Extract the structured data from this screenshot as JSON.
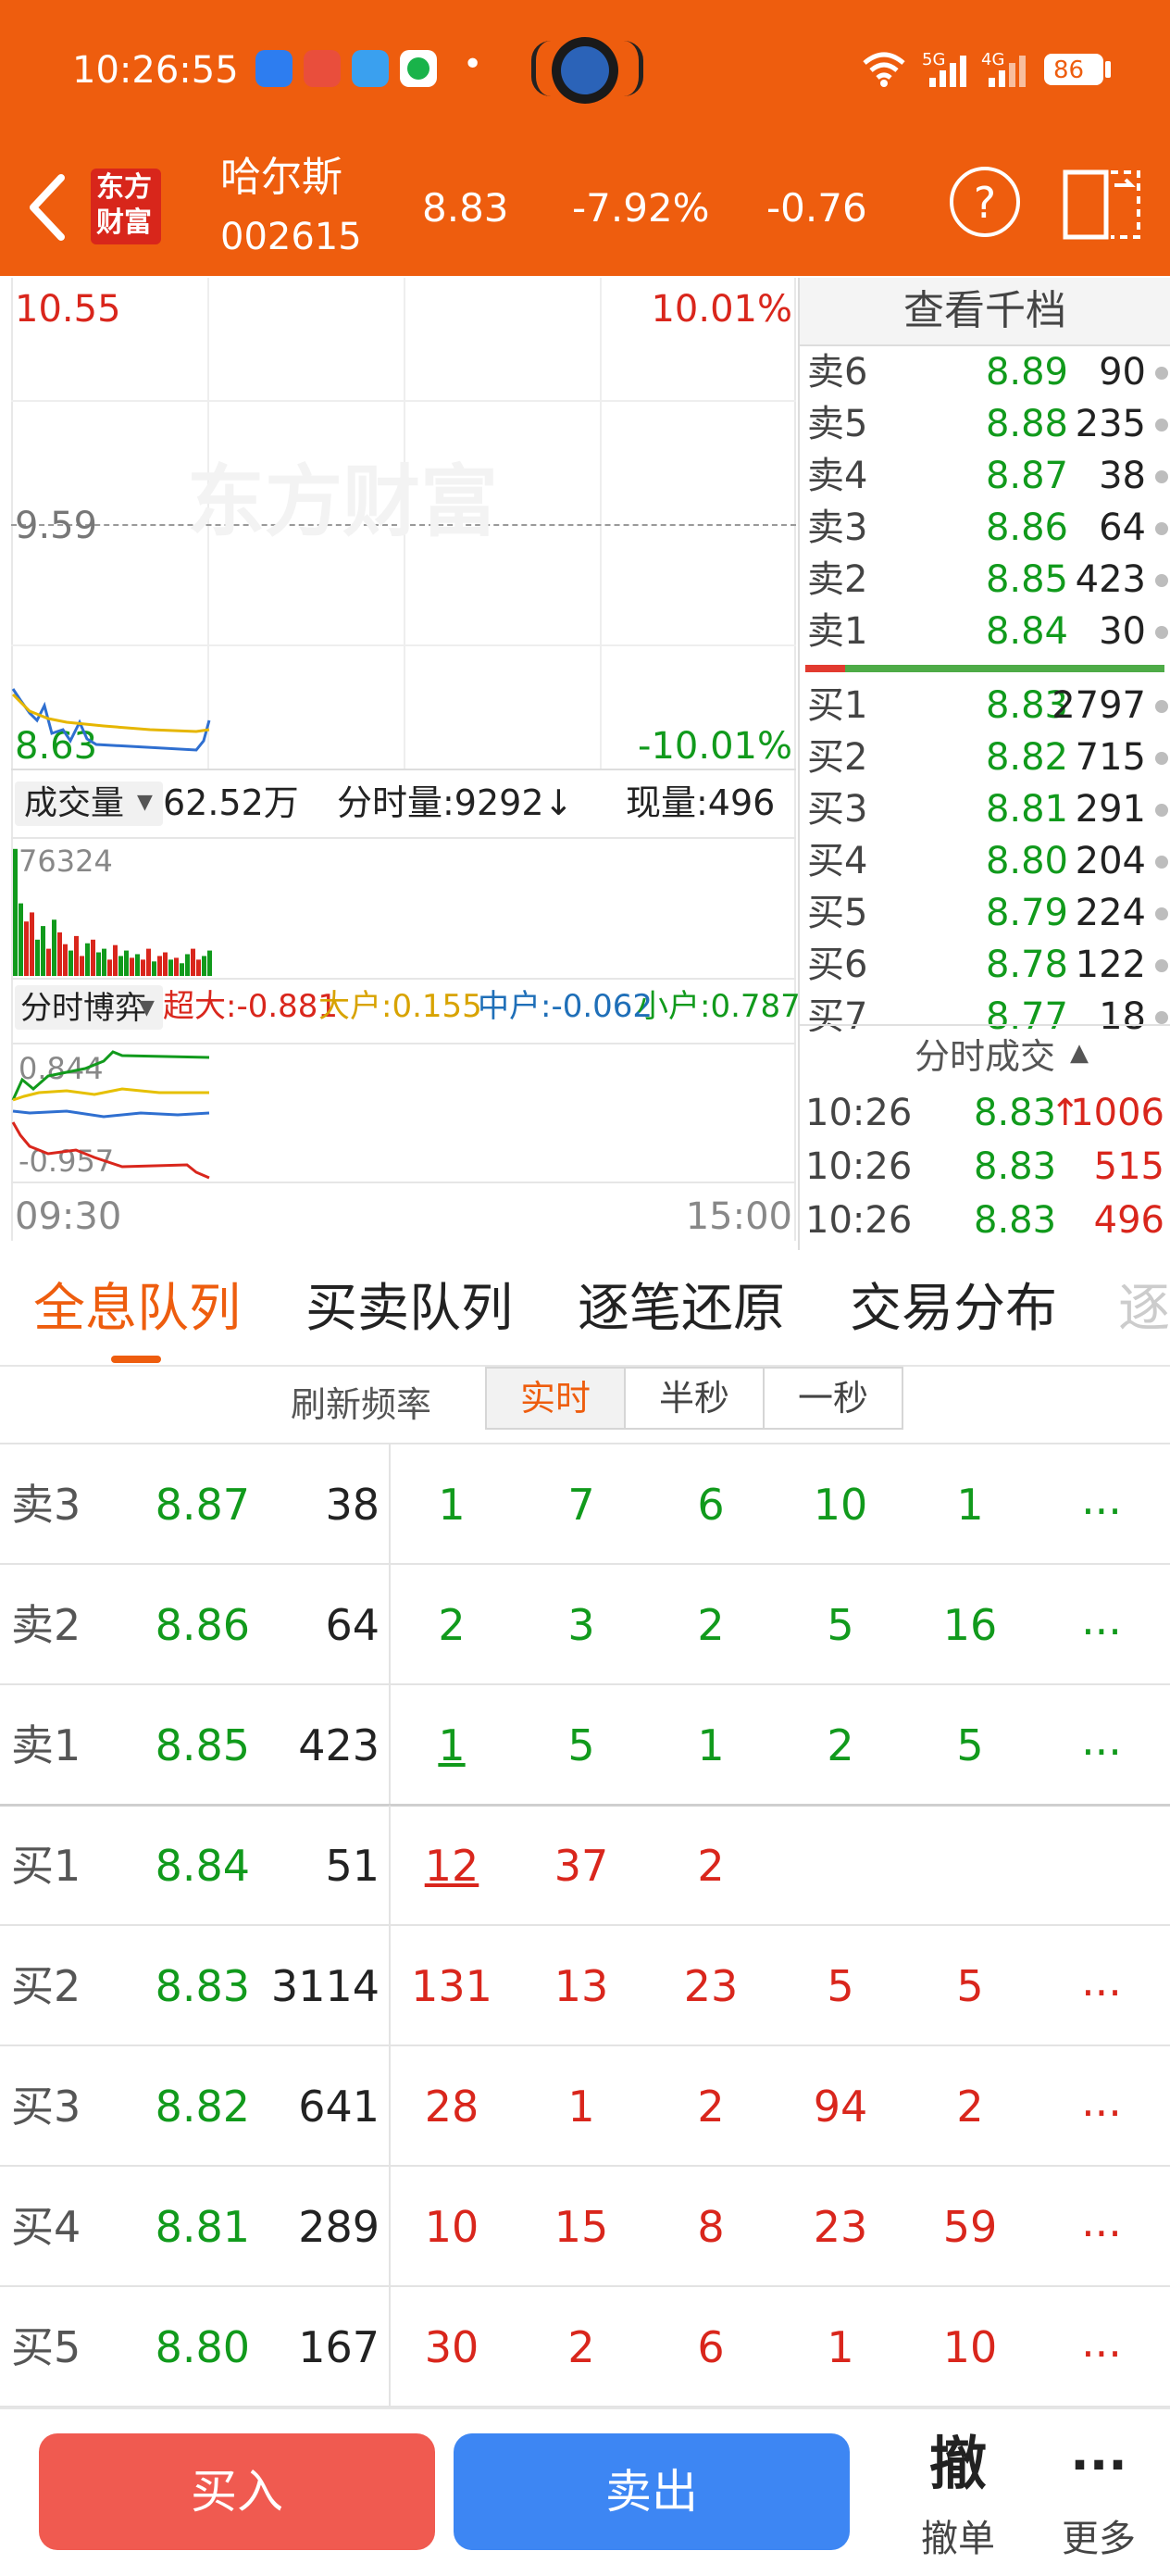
{
  "status_bar": {
    "time": "10:26:55",
    "signal_5g": "5G",
    "signal_4g": "4G",
    "battery": "86",
    "app_dot": "•"
  },
  "header": {
    "logo_line1": "东方",
    "logo_line2": "财富",
    "stock_name": "哈尔斯",
    "stock_code": "002615",
    "price": "8.83",
    "change_pct": "-7.92%",
    "change": "-0.76",
    "help": "?"
  },
  "chart": {
    "price_high": "10.55",
    "pct_high": "10.01%",
    "price_mid": "9.59",
    "price_low": "8.63",
    "pct_low": "-10.01%",
    "watermark": "东方财富",
    "volume_selector": "成交量",
    "volume_total": "62.52万",
    "fenshi_label": "分时量:9292↓",
    "current_label": "现量:496",
    "vol_max": "76324",
    "boyi_selector": "分时博弈",
    "chaoda": "超大:-0.881",
    "dahu": "大户:0.155",
    "zhonghu": "中户:-0.062",
    "xiaohu": "小户:0.787",
    "boyi_max": "0.844",
    "boyi_min": "-0.957",
    "time_start": "09:30",
    "time_end": "15:00"
  },
  "orderbook": {
    "title": "查看千档",
    "asks": [
      {
        "label": "卖6",
        "price": "8.89",
        "vol": "90"
      },
      {
        "label": "卖5",
        "price": "8.88",
        "vol": "235"
      },
      {
        "label": "卖4",
        "price": "8.87",
        "vol": "38"
      },
      {
        "label": "卖3",
        "price": "8.86",
        "vol": "64"
      },
      {
        "label": "卖2",
        "price": "8.85",
        "vol": "423"
      },
      {
        "label": "卖1",
        "price": "8.84",
        "vol": "30"
      }
    ],
    "bids": [
      {
        "label": "买1",
        "price": "8.83",
        "vol": "2797"
      },
      {
        "label": "买2",
        "price": "8.82",
        "vol": "715"
      },
      {
        "label": "买3",
        "price": "8.81",
        "vol": "291"
      },
      {
        "label": "买4",
        "price": "8.80",
        "vol": "204"
      },
      {
        "label": "买5",
        "price": "8.79",
        "vol": "224"
      },
      {
        "label": "买6",
        "price": "8.78",
        "vol": "122"
      },
      {
        "label": "买7",
        "price": "8.77",
        "vol": "18"
      }
    ],
    "buy_ratio": 0.11
  },
  "ticks": {
    "title": "分时成交",
    "rows": [
      {
        "time": "10:26",
        "price": "8.83",
        "vol": "1006",
        "arrow": "↑"
      },
      {
        "time": "10:26",
        "price": "8.83",
        "vol": "515",
        "arrow": ""
      },
      {
        "time": "10:26",
        "price": "8.83",
        "vol": "496",
        "arrow": ""
      }
    ]
  },
  "tabs": [
    "全息队列",
    "买卖队列",
    "逐笔还原",
    "交易分布",
    "逐"
  ],
  "refresh": {
    "label": "刷新频率",
    "options": [
      "实时",
      "半秒",
      "一秒"
    ]
  },
  "queue": {
    "rows": [
      {
        "label": "卖3",
        "price": "8.87",
        "vol": "38",
        "orders": [
          "1",
          "7",
          "6",
          "10",
          "1"
        ],
        "more": "..."
      },
      {
        "label": "卖2",
        "price": "8.86",
        "vol": "64",
        "orders": [
          "2",
          "3",
          "2",
          "5",
          "16"
        ],
        "more": "..."
      },
      {
        "label": "卖1",
        "price": "8.85",
        "vol": "423",
        "orders": [
          "1",
          "5",
          "1",
          "2",
          "5"
        ],
        "more": "..."
      },
      {
        "label": "买1",
        "price": "8.84",
        "vol": "51",
        "orders": [
          "12",
          "37",
          "2",
          "",
          ""
        ],
        "more": ""
      },
      {
        "label": "买2",
        "price": "8.83",
        "vol": "3114",
        "orders": [
          "131",
          "13",
          "23",
          "5",
          "5"
        ],
        "more": "..."
      },
      {
        "label": "买3",
        "price": "8.82",
        "vol": "641",
        "orders": [
          "28",
          "1",
          "2",
          "94",
          "2"
        ],
        "more": "..."
      },
      {
        "label": "买4",
        "price": "8.81",
        "vol": "289",
        "orders": [
          "10",
          "15",
          "8",
          "23",
          "59"
        ],
        "more": "..."
      },
      {
        "label": "买5",
        "price": "8.80",
        "vol": "167",
        "orders": [
          "30",
          "2",
          "6",
          "1",
          "10"
        ],
        "more": "..."
      }
    ]
  },
  "bottom": {
    "buy": "买入",
    "sell": "卖出",
    "cancel_icon": "撤",
    "cancel": "撤单",
    "more_icon": "···",
    "more": "更多"
  },
  "colors": {
    "brand": "#ee5d0e",
    "up": "#d9261c",
    "down": "#119a1c",
    "buy_button": "#f05a50",
    "sell_button": "#3d86f3"
  }
}
